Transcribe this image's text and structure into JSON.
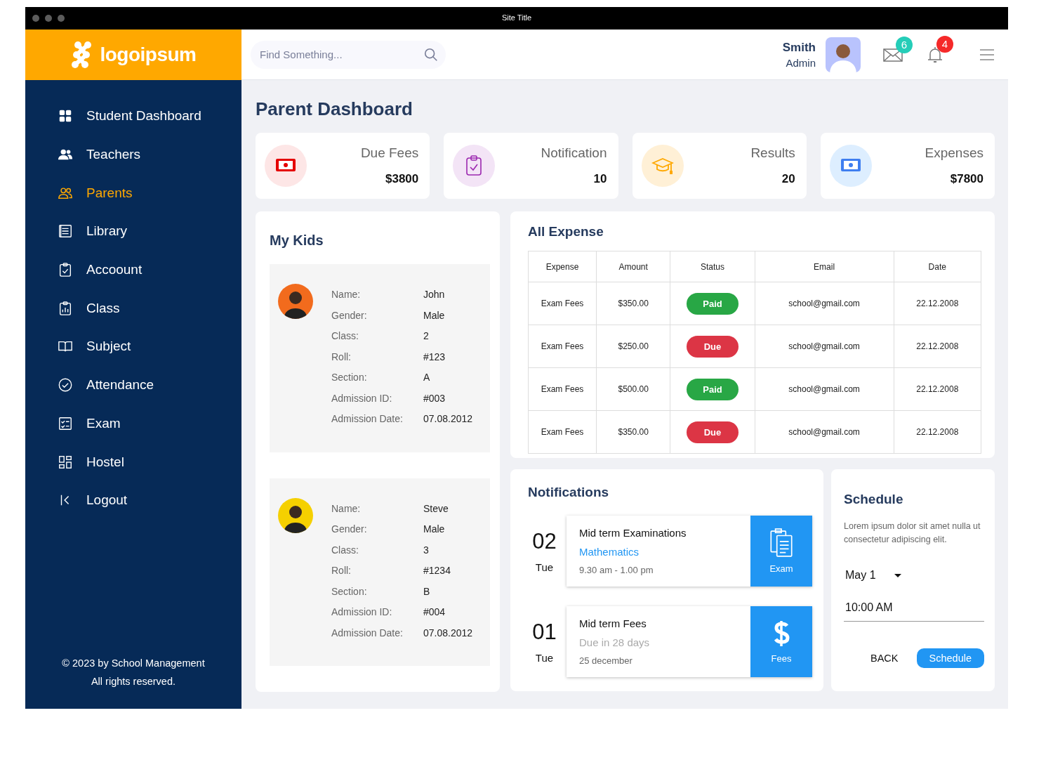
{
  "window": {
    "title": "Site Title"
  },
  "brand": {
    "logo": "logoipsum"
  },
  "sidebar": {
    "items": [
      {
        "label": "Student Dashboard",
        "selected": false
      },
      {
        "label": "Teachers",
        "selected": false
      },
      {
        "label": "Parents",
        "selected": true
      },
      {
        "label": "Library",
        "selected": false
      },
      {
        "label": "Accoount",
        "selected": false
      },
      {
        "label": "Class",
        "selected": false
      },
      {
        "label": "Subject",
        "selected": false
      },
      {
        "label": "Attendance",
        "selected": false
      },
      {
        "label": "Exam",
        "selected": false
      },
      {
        "label": "Hostel",
        "selected": false
      },
      {
        "label": "Logout",
        "selected": false
      }
    ],
    "footer": [
      "© 2023 by School Management",
      "All rights reserved."
    ]
  },
  "header": {
    "search": {
      "placeholder": "Find Something..."
    },
    "user": {
      "name": "Smith",
      "role": "Admin"
    },
    "mail_count": "6",
    "alert_count": "4"
  },
  "page_title": "Parent Dashboard",
  "stats": [
    {
      "kind": "fees",
      "label": "Due Fees",
      "value": "$3800"
    },
    {
      "kind": "notification",
      "label": "Notification",
      "value": "10"
    },
    {
      "kind": "results",
      "label": "Results",
      "value": "20"
    },
    {
      "kind": "expenses",
      "label": "Expenses",
      "value": "$7800"
    }
  ],
  "my_kids": {
    "title": "My Kids",
    "kids": [
      {
        "color": "#f26b1d",
        "fields": [
          {
            "label": "Name:",
            "value": "John"
          },
          {
            "label": "Gender:",
            "value": "Male"
          },
          {
            "label": "Class:",
            "value": "2"
          },
          {
            "label": "Roll:",
            "value": "#123"
          },
          {
            "label": "Section:",
            "value": "A"
          },
          {
            "label": "Admission ID:",
            "value": "#003"
          },
          {
            "label": "Admission Date:",
            "value": "07.08.2012"
          }
        ]
      },
      {
        "color": "#f5d000",
        "fields": [
          {
            "label": "Name:",
            "value": "Steve"
          },
          {
            "label": "Gender:",
            "value": "Male"
          },
          {
            "label": "Class:",
            "value": "3"
          },
          {
            "label": "Roll:",
            "value": "#1234"
          },
          {
            "label": "Section:",
            "value": "B"
          },
          {
            "label": "Admission ID:",
            "value": "#004"
          },
          {
            "label": "Admission Date:",
            "value": "07.08.2012"
          }
        ]
      }
    ]
  },
  "all_expense": {
    "title": "All Expense",
    "columns": [
      "Expense",
      "Amount",
      "Status",
      "Email",
      "Date"
    ],
    "rows": [
      {
        "expense": "Exam Fees",
        "amount": "$350.00",
        "status": "Paid",
        "color": "#28a745",
        "email": "school@gmail.com",
        "date": "22.12.2008"
      },
      {
        "expense": "Exam Fees",
        "amount": "$250.00",
        "status": "Due",
        "color": "#dc3545",
        "email": "school@gmail.com",
        "date": "22.12.2008"
      },
      {
        "expense": "Exam Fees",
        "amount": "$500.00",
        "status": "Paid",
        "color": "#28a745",
        "email": "school@gmail.com",
        "date": "22.12.2008"
      },
      {
        "expense": "Exam Fees",
        "amount": "$350.00",
        "status": "Due",
        "color": "#dc3545",
        "email": "school@gmail.com",
        "date": "22.12.2008"
      }
    ]
  },
  "notifications": {
    "title": "Notifications",
    "items": [
      {
        "kind": "exam",
        "day": "02",
        "weekday": "Tue",
        "title": "Mid term Examinations",
        "subtitle": "Mathematics",
        "detail": "9.30 am - 1.00 pm",
        "tag": "Exam"
      },
      {
        "kind": "fees",
        "day": "01",
        "weekday": "Tue",
        "title": "Mid term Fees",
        "subtitle": "Due in 28 days",
        "detail": "25 december",
        "tag": "Fees"
      }
    ]
  },
  "schedule": {
    "title": "Schedule",
    "text": "Lorem ipsum dolor sit amet nulla ut  consectetur adipiscing elit.",
    "date": "May 1",
    "time": "10:00 AM",
    "buttons": [
      "BACK",
      "Schedule"
    ]
  }
}
